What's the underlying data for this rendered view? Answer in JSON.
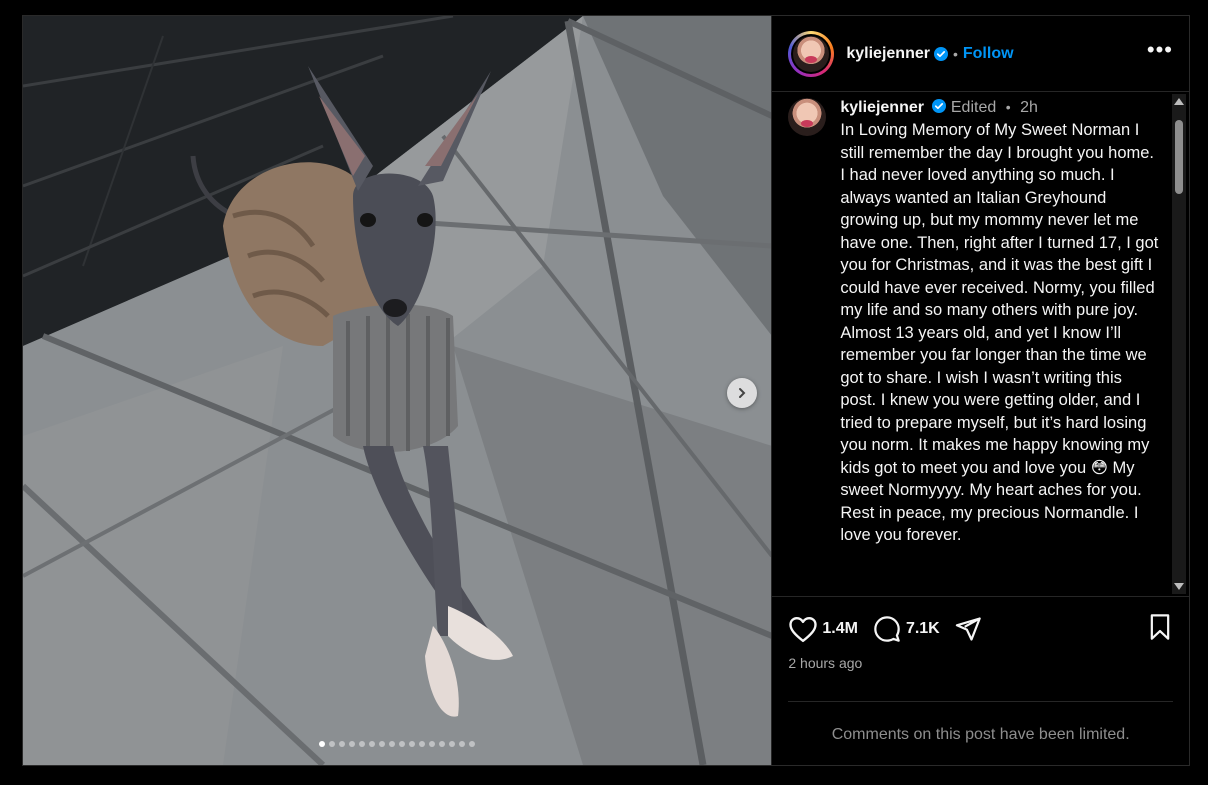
{
  "header": {
    "username": "kyliejenner",
    "separator": "•",
    "follow_label": "Follow",
    "more_label": "•••"
  },
  "caption": {
    "username": "kyliejenner",
    "edited": "Edited",
    "separator": "•",
    "time": "2h",
    "text": "In Loving Memory of My Sweet Norman I still remember the day I brought you home. I had never loved anything so much. I always wanted an Italian Greyhound growing up, but my mommy never let me have one. Then, right after I turned 17, I got you for Christmas, and it was the best gift I could have ever received. Normy, you filled my life and so many others with pure joy. Almost 13 years old, and yet I know I’ll remember you far longer than the time we got to share. I wish I wasn’t writing this post. I knew you were getting older, and I tried to prepare myself, but it’s hard losing you norm. It makes me happy knowing my kids got to meet you and love you 😳 My sweet Normyyyy. My heart aches for you. Rest in peace, my precious Normandle. I love you forever."
  },
  "actions": {
    "likes": "1.4M",
    "comments": "7.1K",
    "timestamp": "2 hours ago"
  },
  "footer": {
    "limited_text": "Comments on this post have been limited."
  },
  "carousel": {
    "active_index": 0
  },
  "colors": {
    "follow": "#0095f6",
    "verified": "#0095f6",
    "muted": "#a8a8a8",
    "background": "#000000"
  },
  "icons": [
    "verified-badge-icon",
    "more-options-icon",
    "chevron-right-icon",
    "heart-icon",
    "comment-icon",
    "share-icon",
    "bookmark-icon"
  ]
}
